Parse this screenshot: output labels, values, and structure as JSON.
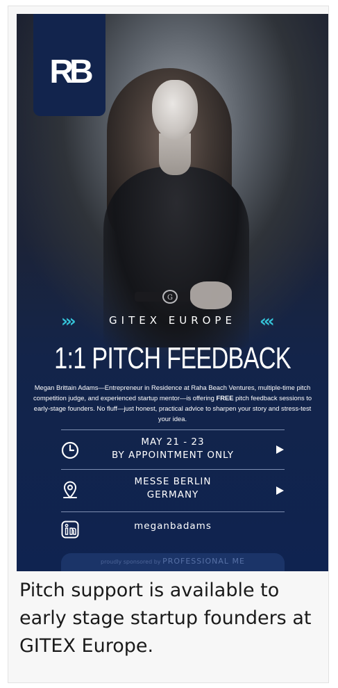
{
  "poster": {
    "logo": "RB",
    "event_name": "GITEX EUROPE",
    "event_chevrons_left": "›››",
    "event_chevrons_right": "‹‹‹",
    "headline": "1:1 PITCH FEEDBACK",
    "description_pre": "Megan Brittain Adams—Entrepreneur in Residence at Raha Beach Ventures, multiple-time pitch competition judge, and experienced startup mentor—is offering ",
    "description_bold": "FREE",
    "description_post": " pitch feedback sessions to early-stage founders. No fluff—just honest, practical advice to sharpen your story and stress-test your idea.",
    "buckle_text": "G",
    "info": [
      {
        "icon": "clock-icon",
        "line1": "MAY 21 - 23",
        "line2": "BY APPOINTMENT ONLY",
        "has_arrow": true
      },
      {
        "icon": "location-pin-icon",
        "line1": "MESSE BERLIN",
        "line2": "GERMANY",
        "has_arrow": true
      },
      {
        "icon": "linkedin-icon",
        "line1": "meganbadams",
        "line2": "",
        "has_arrow": false
      }
    ],
    "sponsor_prefix": "proudly sponsored by",
    "sponsor_brand": "PROFESSIONAL ME"
  },
  "caption": "Pitch support is available to early stage startup founders at GITEX Europe.",
  "colors": {
    "navy": "#12244d",
    "accent_cyan": "#35c3d8",
    "caption_text": "#1a1a1a"
  }
}
